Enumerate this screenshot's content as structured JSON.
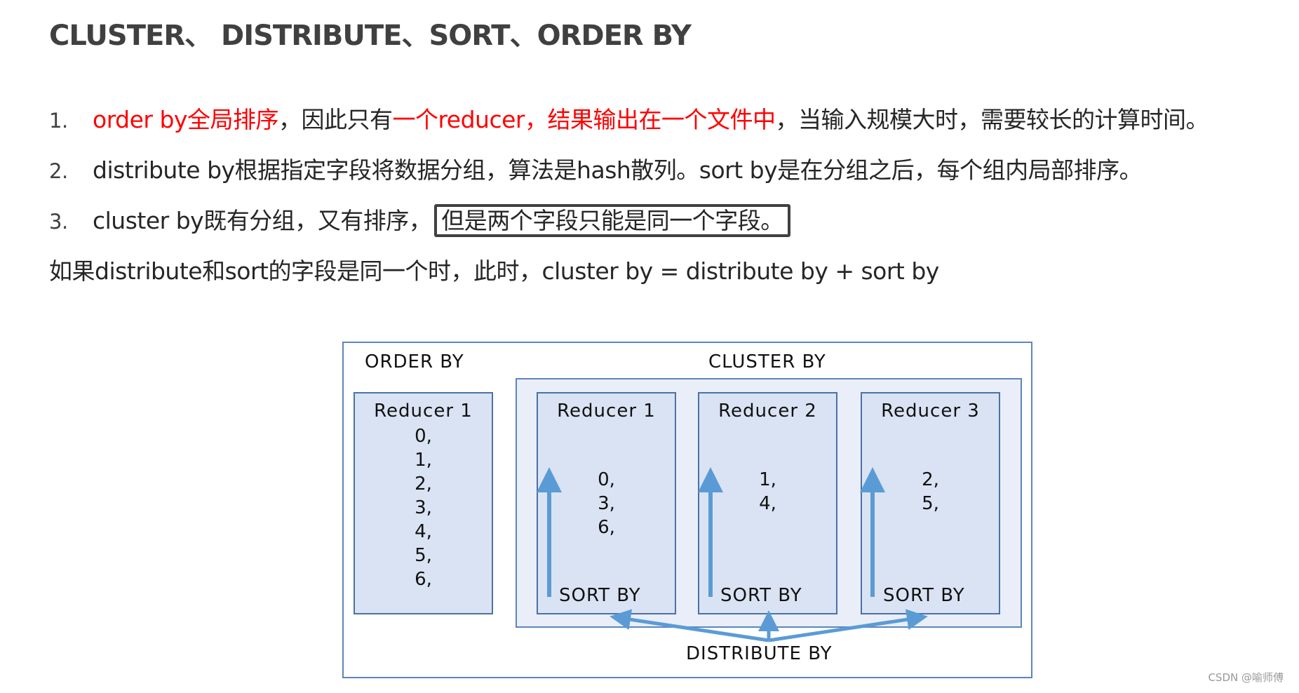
{
  "title": "CLUSTER、 DISTRIBUTE、SORT、ORDER BY",
  "points": [
    {
      "number": "1.",
      "segments": [
        {
          "text": "order by全局排序",
          "color": "red"
        },
        {
          "text": "，因此只有",
          "color": "normal"
        },
        {
          "text": "一个reducer，结果输出在一个文件中",
          "color": "red"
        },
        {
          "text": "，当输入规模大时，需要较长的计算时间。",
          "color": "normal"
        }
      ]
    },
    {
      "number": "2.",
      "segments": [
        {
          "text": "distribute by根据指定字段将数据分组，算法是hash散列。sort by是在分组之后，每个组内局部排序。",
          "color": "normal"
        }
      ]
    },
    {
      "number": "3.",
      "text": "cluster by既有分组，又有排序，",
      "boxed_text": "但是两个字段只能是同一个字段。"
    }
  ],
  "note": "如果distribute和sort的字段是同一个时，此时，cluster by = distribute by + sort by",
  "diagram": {
    "order_by_label": "ORDER BY",
    "cluster_by_label": "CLUSTER BY",
    "distribute_by_label": "DISTRIBUTE BY",
    "order_by_reducer": {
      "title": "Reducer 1",
      "values": [
        "0,",
        "1,",
        "2,",
        "3,",
        "4,",
        "5,",
        "6,"
      ]
    },
    "cluster_reducers": [
      {
        "title": "Reducer 1",
        "values": [
          "0,",
          "3,",
          "6,"
        ],
        "sort_label": "SORT BY"
      },
      {
        "title": "Reducer 2",
        "values": [
          "1,",
          "4,"
        ],
        "sort_label": "SORT BY"
      },
      {
        "title": "Reducer 3",
        "values": [
          "2,",
          "5,"
        ],
        "sort_label": "SORT BY"
      }
    ],
    "colors": {
      "arrow": "#5b9bd5",
      "reducer_fill": "#dae3f3",
      "cluster_fill": "#e9eef8",
      "border": "#5b86bd"
    }
  },
  "watermark": "CSDN @喻师傅"
}
